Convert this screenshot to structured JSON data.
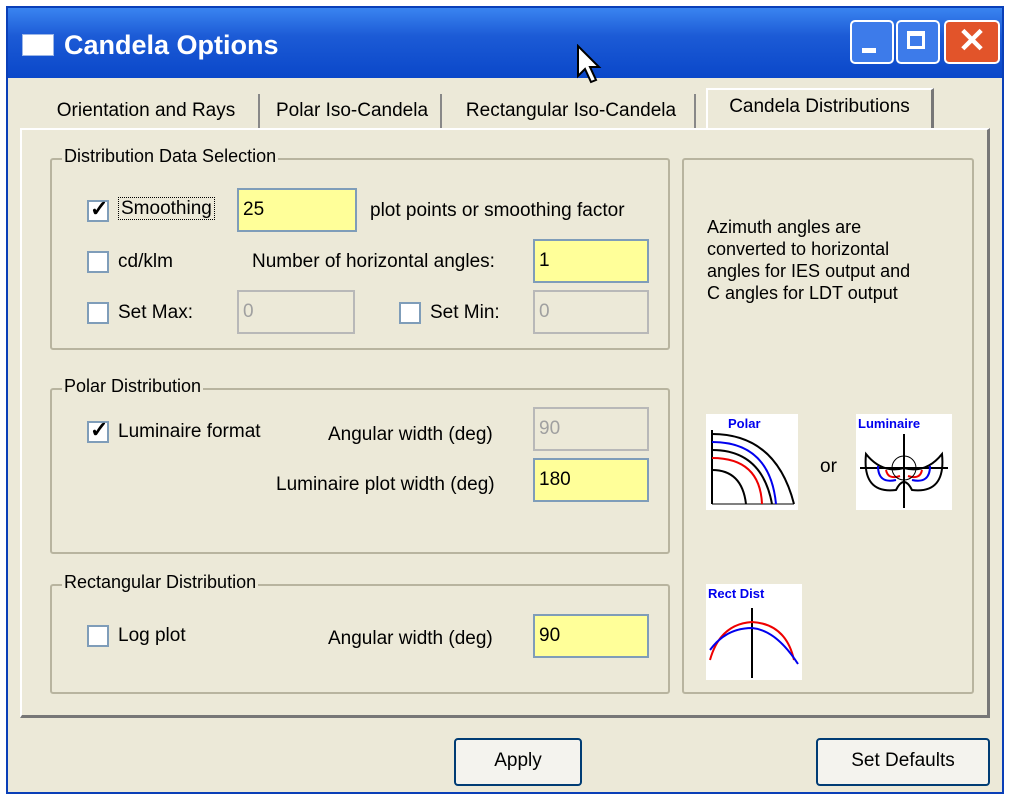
{
  "window": {
    "title": "Candela Options"
  },
  "tabs": [
    {
      "label": "Orientation and Rays"
    },
    {
      "label": "Polar Iso-Candela"
    },
    {
      "label": "Rectangular Iso-Candela"
    },
    {
      "label": "Candela Distributions"
    }
  ],
  "distribution_selection": {
    "legend": "Distribution Data Selection",
    "smoothing": {
      "label": "Smoothing",
      "checked": true,
      "value": "25",
      "suffix": "plot points or smoothing factor"
    },
    "cd_klm": {
      "label": "cd/klm",
      "checked": false
    },
    "horizontal_angles": {
      "label": "Number of horizontal angles:",
      "value": "1"
    },
    "set_max": {
      "label": "Set Max:",
      "checked": false,
      "value": "0"
    },
    "set_min": {
      "label": "Set Min:",
      "checked": false,
      "value": "0"
    }
  },
  "polar_distribution": {
    "legend": "Polar Distribution",
    "luminaire_format": {
      "label": "Luminaire format",
      "checked": true
    },
    "angular_width": {
      "label": "Angular width (deg)",
      "value": "90"
    },
    "luminaire_plot_width": {
      "label": "Luminaire plot width (deg)",
      "value": "180"
    }
  },
  "rectangular_distribution": {
    "legend": "Rectangular Distribution",
    "log_plot": {
      "label": "Log plot",
      "checked": false
    },
    "angular_width": {
      "label": "Angular width (deg)",
      "value": "90"
    }
  },
  "info": {
    "lines": [
      "Azimuth angles are",
      "converted to horizontal",
      "angles for IES output and",
      "C angles for LDT output"
    ],
    "or_label": "or",
    "thumb_polar": "Polar",
    "thumb_luminaire": "Luminaire",
    "thumb_rect": "Rect Dist"
  },
  "buttons": {
    "apply": "Apply",
    "set_defaults": "Set Defaults"
  },
  "colors": {
    "input_active": "#ffff99",
    "title_bar": "#0a47c9",
    "close": "#e2542a"
  }
}
